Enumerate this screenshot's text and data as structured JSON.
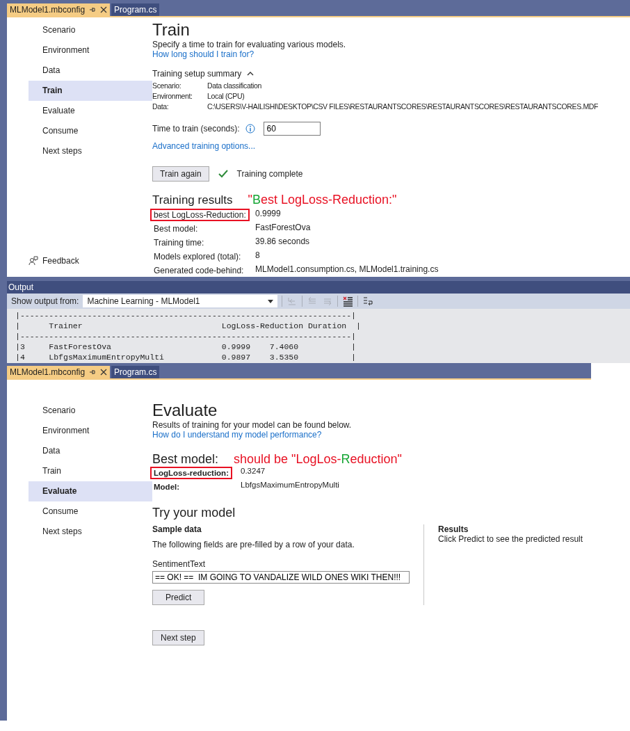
{
  "train_view": {
    "tabs": [
      {
        "label": "MLModel1.mbconfig",
        "selected": true
      },
      {
        "label": "Program.cs",
        "selected": false
      }
    ],
    "steps": [
      {
        "label": "Scenario",
        "selected": false
      },
      {
        "label": "Environment",
        "selected": false
      },
      {
        "label": "Data",
        "selected": false
      },
      {
        "label": "Train",
        "selected": true
      },
      {
        "label": "Evaluate",
        "selected": false
      },
      {
        "label": "Consume",
        "selected": false
      },
      {
        "label": "Next steps",
        "selected": false
      }
    ],
    "feedback": "Feedback",
    "heading": "Train",
    "description": "Specify a time to train for evaluating various models.",
    "help_link": "How long should I train for?",
    "summary": {
      "title": "Training setup summary",
      "expanded": true,
      "rows": [
        {
          "label": "Scenario:",
          "value": "Data classification"
        },
        {
          "label": "Environment:",
          "value": "Local (CPU)"
        },
        {
          "label": "Data:",
          "value": "C:\\USERS\\V-HAILISHI\\DESKTOP\\CSV FILES\\RESTAURANTSCORES\\RESTAURANTSCORES\\RESTAURANTSCORES.MDF"
        }
      ]
    },
    "time_field": {
      "label": "Time to train (seconds):",
      "value": "60"
    },
    "advanced_link": "Advanced training options...",
    "train_button": "Train again",
    "status": "Training complete",
    "results": {
      "title": "Training results",
      "annotation": [
        {
          "text": "\"",
          "color": "#e81123"
        },
        {
          "text": "B",
          "color": "#16a635"
        },
        {
          "text": "est LogLoss-Reduction:\"",
          "color": "#e81123"
        }
      ],
      "rows": [
        {
          "label": "best LogLoss-Reduction:",
          "value": "0.9999",
          "highlighted": true
        },
        {
          "label": "Best model:",
          "value": "FastForestOva",
          "highlighted": false
        },
        {
          "label": "Training time:",
          "value": "39.86 seconds",
          "highlighted": false
        },
        {
          "label": "Models explored (total):",
          "value": "8",
          "highlighted": false
        },
        {
          "label": "Generated code-behind:",
          "value": "MLModel1.consumption.cs, MLModel1.training.cs",
          "highlighted": false
        }
      ]
    }
  },
  "output": {
    "title": "Output",
    "show_from_label": "Show output from:",
    "source": "Machine Learning - MLModel1",
    "lines": [
      "|---------------------------------------------------------------------|",
      "|      Trainer                             LogLoss-Reduction Duration  |",
      "|---------------------------------------------------------------------|",
      "|3     FastForestOva                       0.9999    7.4060           |",
      "|4     LbfgsMaximumEntropyMulti            0.9897    3.5350           |"
    ]
  },
  "evaluate_view": {
    "tabs": [
      {
        "label": "MLModel1.mbconfig",
        "selected": true
      },
      {
        "label": "Program.cs",
        "selected": false
      }
    ],
    "steps": [
      {
        "label": "Scenario",
        "selected": false
      },
      {
        "label": "Environment",
        "selected": false
      },
      {
        "label": "Data",
        "selected": false
      },
      {
        "label": "Train",
        "selected": false
      },
      {
        "label": "Evaluate",
        "selected": true
      },
      {
        "label": "Consume",
        "selected": false
      },
      {
        "label": "Next steps",
        "selected": false
      }
    ],
    "heading": "Evaluate",
    "description": "Results of training for your model can be found below.",
    "help_link": "How do I understand my model performance?",
    "best_model": {
      "title": "Best model:",
      "annotation": [
        {
          "text": "should be \"LogLos-",
          "color": "#e81123"
        },
        {
          "text": "R",
          "color": "#16a635"
        },
        {
          "text": "eduction\"",
          "color": "#e81123"
        }
      ],
      "rows": [
        {
          "label": "LogLoss-reduction:",
          "value": "0.3247",
          "highlighted": true
        },
        {
          "label": "Model:",
          "value": "LbfgsMaximumEntropyMulti",
          "highlighted": false
        }
      ]
    },
    "try": {
      "title": "Try your model",
      "sample": {
        "title": "Sample data",
        "description": "The following fields are pre-filled by a row of your data.",
        "field_label": "SentimentText",
        "field_value": "== OK! ==  IM GOING TO VANDALIZE WILD ONES WIKI THEN!!!",
        "button": "Predict"
      },
      "results": {
        "title": "Results",
        "text": "Click Predict to see the predicted result"
      }
    },
    "next_button": "Next step"
  }
}
